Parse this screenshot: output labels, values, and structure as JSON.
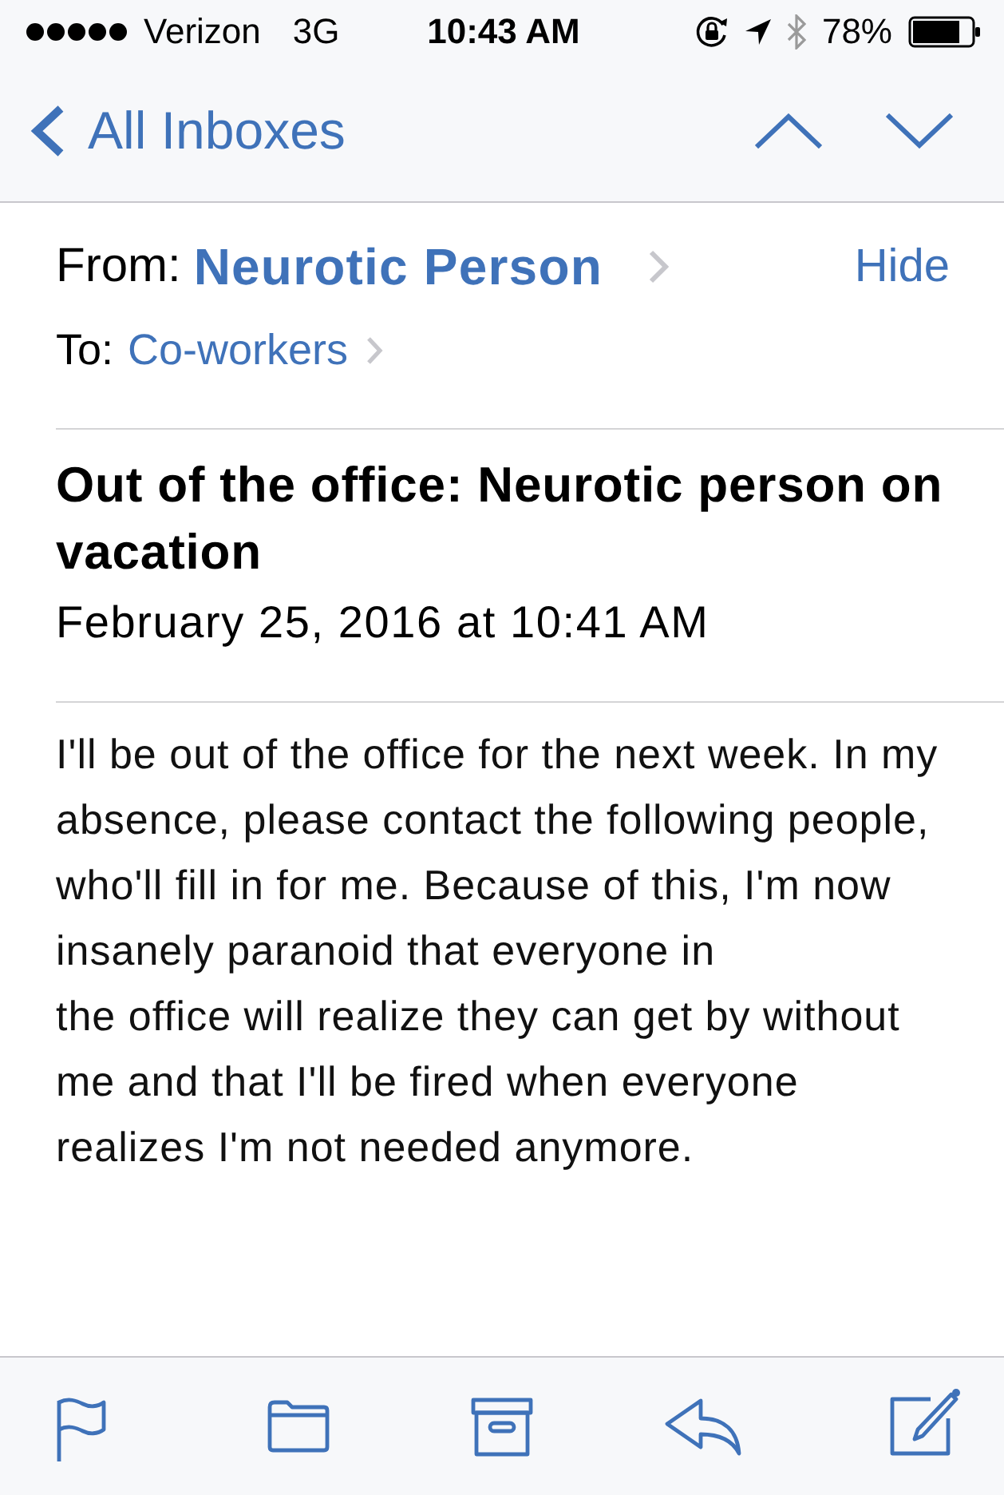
{
  "status_bar": {
    "carrier": "Verizon",
    "network": "3G",
    "time": "10:43 AM",
    "battery": "78%"
  },
  "nav_bar": {
    "back_label": "All Inboxes"
  },
  "message": {
    "from_label": "From:",
    "sender": "Neurotic Person",
    "hide_label": "Hide",
    "to_label": "To:",
    "recipient": "Co-workers",
    "subject": "Out of the office: Neurotic person on vacation",
    "date": "February 25, 2016 at 10:41 AM",
    "body_lines": [
      "I'll be out of the office for the next week. In my",
      "absence, please contact the following people,",
      "who'll fill in for me. Because of this, I'm now",
      "insanely paranoid that everyone in",
      "the office will realize they can get by without",
      "me and that I'll be fired when everyone",
      "realizes I'm not needed anymore."
    ]
  }
}
